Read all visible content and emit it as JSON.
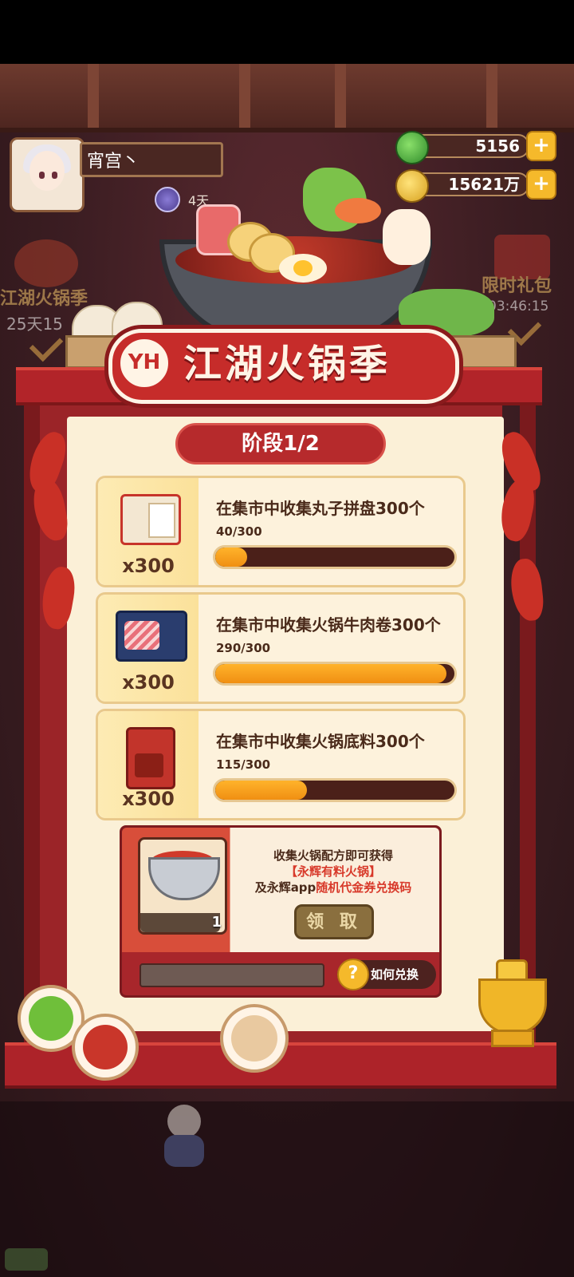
{
  "player": {
    "name": "宵宫丶",
    "vip_days": "4天"
  },
  "currency": {
    "gems": "5156",
    "coins": "15621万"
  },
  "side_events": {
    "left_label": "江湖火锅季",
    "left_timer": "25天15",
    "right_label": "限时礼包",
    "right_timer": "03:46:15"
  },
  "event": {
    "logo": "YH",
    "title": "江湖火锅季",
    "stage": "阶段1/2"
  },
  "tasks": [
    {
      "desc": "在集市中收集丸子拼盘300个",
      "progress_text": "40/300",
      "progress": 0.133,
      "qty": "x300",
      "item_icon": "meatball-platter-icon"
    },
    {
      "desc": "在集市中收集火锅牛肉卷300个",
      "progress_text": "290/300",
      "progress": 0.967,
      "qty": "x300",
      "item_icon": "beef-roll-icon"
    },
    {
      "desc": "在集市中收集火锅底料300个",
      "progress_text": "115/300",
      "progress": 0.383,
      "qty": "x300",
      "item_icon": "hotpot-base-icon"
    }
  ],
  "reward": {
    "line1": "收集火锅配方即可获得",
    "line2": "【永辉有料火锅】",
    "line3_prefix": "及永辉app",
    "line3_highlight": "随机代金券兑换码",
    "count": "1",
    "claim_label": "领 取",
    "howto_label": "如何兑换"
  },
  "colors": {
    "accent_red": "#b22429",
    "progress_orange": "#f5a21e",
    "gold": "#f5b92b"
  }
}
